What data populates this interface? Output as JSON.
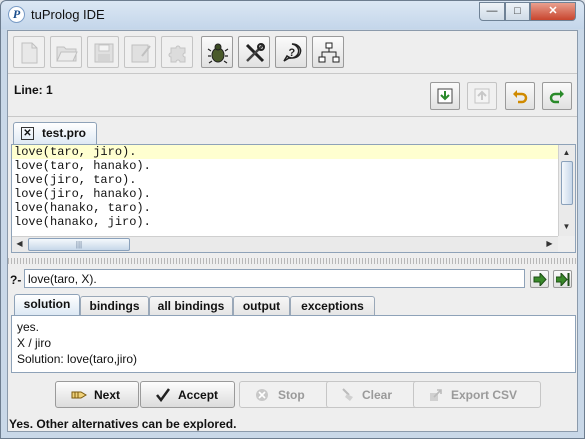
{
  "window": {
    "title": "tuProlog IDE",
    "app_icon_letter": "P"
  },
  "toolbar": {
    "buttons": [
      {
        "name": "new-file-icon",
        "enabled": false
      },
      {
        "name": "open-folder-icon",
        "enabled": false
      },
      {
        "name": "save-icon",
        "enabled": false
      },
      {
        "name": "save-as-icon",
        "enabled": false
      },
      {
        "name": "puzzle-icon",
        "enabled": false
      },
      {
        "name": "debug-bug-icon",
        "enabled": true
      },
      {
        "name": "tools-icon",
        "enabled": true
      },
      {
        "name": "help-icon",
        "enabled": true
      },
      {
        "name": "network-icon",
        "enabled": true
      }
    ]
  },
  "linebar": {
    "line_label": "Line: 1"
  },
  "editor": {
    "tab_label": "test.pro",
    "tab_close_glyph": "✕",
    "lines": [
      "love(taro, jiro).",
      "love(taro, hanako).",
      "love(jiro, taro).",
      "love(jiro, hanako).",
      "love(hanako, taro).",
      "love(hanako, jiro)."
    ],
    "current_line": 1
  },
  "query": {
    "prompt": "?-",
    "value": "love(taro, X)."
  },
  "result_tabs": [
    {
      "label": "solution",
      "selected": true
    },
    {
      "label": "bindings",
      "selected": false
    },
    {
      "label": "all bindings",
      "selected": false
    },
    {
      "label": "output",
      "selected": false
    },
    {
      "label": "exceptions",
      "selected": false
    }
  ],
  "solution_lines": [
    "yes.",
    "X / jiro",
    "Solution: love(taro,jiro)"
  ],
  "bottom_buttons": {
    "next": "Next",
    "accept": "Accept",
    "stop": "Stop",
    "clear": "Clear",
    "export": "Export CSV"
  },
  "status": "Yes. Other alternatives can be explored.",
  "colors": {
    "accent_green": "#3a8a2a",
    "current_line_bg": "#ffffd0",
    "selection_blue": "#dbe7f3"
  }
}
